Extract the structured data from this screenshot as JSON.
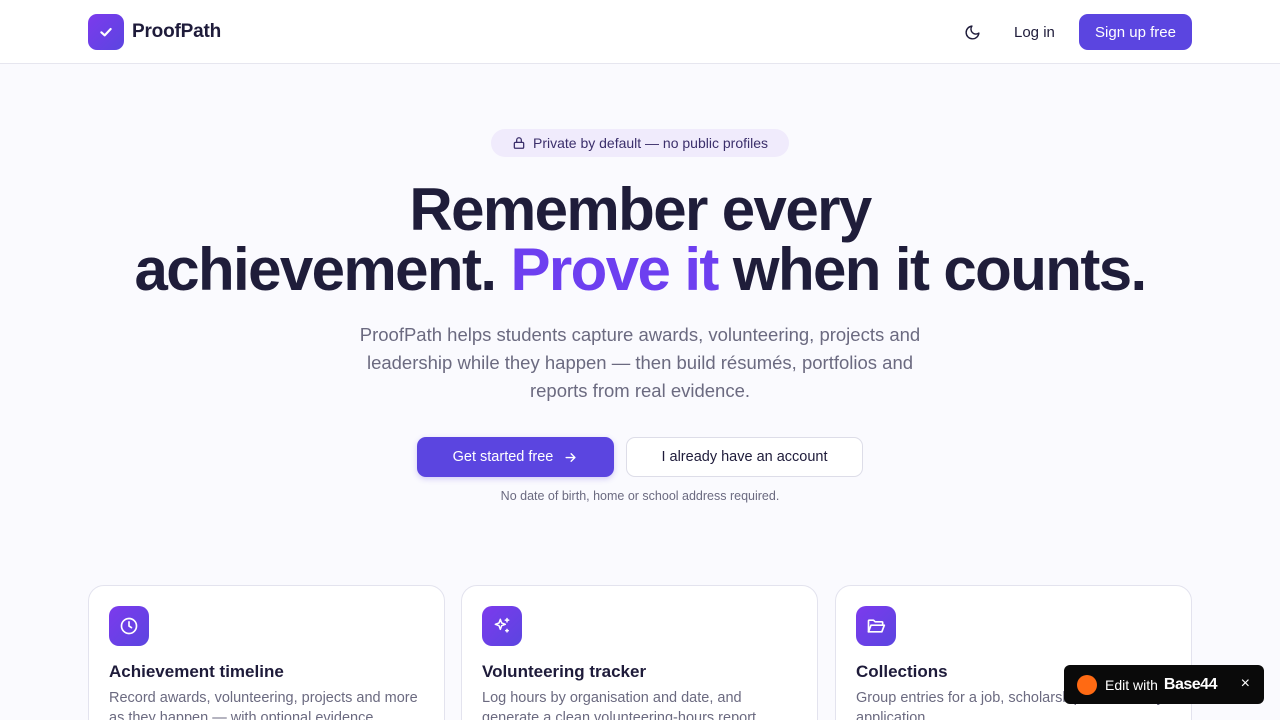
{
  "header": {
    "brand": "ProofPath",
    "login_label": "Log in",
    "signup_label": "Sign up free"
  },
  "hero": {
    "pill_text": "Private by default — no public profiles",
    "headline_line1": "Remember every",
    "headline_line2_start": "achievement.",
    "headline_accent": "Prove it",
    "headline_line2_end": "when it counts.",
    "subtitle": "ProofPath helps students capture awards, volunteering, projects and leadership while they happen — then build résumés, portfolios and reports from real evidence.",
    "cta_primary": "Get started free",
    "cta_secondary": "I already have an account",
    "note": "No date of birth, home or school address required."
  },
  "features": [
    {
      "icon": "clock-icon",
      "title": "Achievement timeline",
      "description": "Record awards, volunteering, projects and more as they happen — with optional evidence."
    },
    {
      "icon": "sparkles-icon",
      "title": "Volunteering tracker",
      "description": "Log hours by organisation and date, and generate a clean volunteering-hours report."
    },
    {
      "icon": "folder-open-icon",
      "title": "Collections",
      "description": "Group entries for a job, scholarship or university application."
    }
  ],
  "badge": {
    "edit_label": "Edit with",
    "brand": "Base44",
    "close": "×"
  },
  "colors": {
    "accent": "#5b45e0",
    "accent_text": "#6d3ff0",
    "background": "#fafafe"
  }
}
